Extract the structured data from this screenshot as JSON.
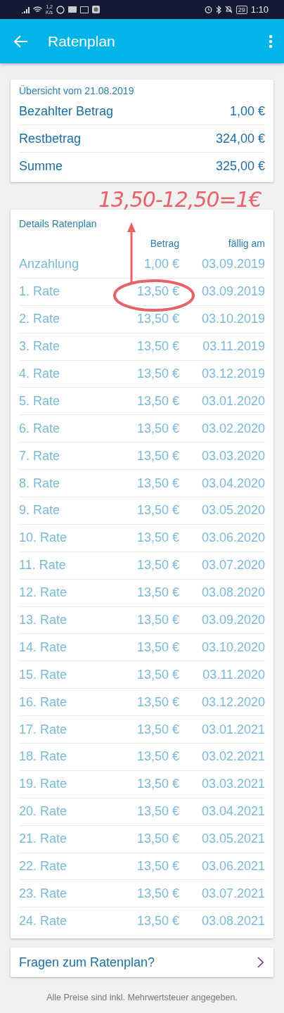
{
  "status_bar": {
    "speed_value": "1,2",
    "speed_unit": "K/s",
    "battery": "29",
    "time": "1:10"
  },
  "app_bar": {
    "title": "Ratenplan"
  },
  "overview": {
    "title": "Übersicht vom 21.08.2019",
    "rows": [
      {
        "label": "Bezahlter Betrag",
        "value": "1,00 €"
      },
      {
        "label": "Restbetrag",
        "value": "324,00 €"
      },
      {
        "label": "Summe",
        "value": "325,00 €"
      }
    ]
  },
  "annotation": {
    "text": "13,50-12,50=1€"
  },
  "details": {
    "title": "Details Ratenplan",
    "columns": [
      "Betrag",
      "fällig am"
    ],
    "rows": [
      {
        "label": "Anzahlung",
        "amount": "1,00 €",
        "due": "03.09.2019"
      },
      {
        "label": "1. Rate",
        "amount": "13,50 €",
        "due": "03.09.2019"
      },
      {
        "label": "2. Rate",
        "amount": "13,50 €",
        "due": "03.10.2019"
      },
      {
        "label": "3. Rate",
        "amount": "13,50 €",
        "due": "03.11.2019"
      },
      {
        "label": "4. Rate",
        "amount": "13,50 €",
        "due": "03.12.2019"
      },
      {
        "label": "5. Rate",
        "amount": "13,50 €",
        "due": "03.01.2020"
      },
      {
        "label": "6. Rate",
        "amount": "13,50 €",
        "due": "03.02.2020"
      },
      {
        "label": "7. Rate",
        "amount": "13,50 €",
        "due": "03.03.2020"
      },
      {
        "label": "8. Rate",
        "amount": "13,50 €",
        "due": "03.04.2020"
      },
      {
        "label": "9. Rate",
        "amount": "13,50 €",
        "due": "03.05.2020"
      },
      {
        "label": "10. Rate",
        "amount": "13,50 €",
        "due": "03.06.2020"
      },
      {
        "label": "11. Rate",
        "amount": "13,50 €",
        "due": "03.07.2020"
      },
      {
        "label": "12. Rate",
        "amount": "13,50 €",
        "due": "03.08.2020"
      },
      {
        "label": "13. Rate",
        "amount": "13,50 €",
        "due": "03.09.2020"
      },
      {
        "label": "14. Rate",
        "amount": "13,50 €",
        "due": "03.10.2020"
      },
      {
        "label": "15. Rate",
        "amount": "13,50 €",
        "due": "03.11.2020"
      },
      {
        "label": "16. Rate",
        "amount": "13,50 €",
        "due": "03.12.2020"
      },
      {
        "label": "17. Rate",
        "amount": "13,50 €",
        "due": "03.01.2021"
      },
      {
        "label": "18. Rate",
        "amount": "13,50 €",
        "due": "03.02.2021"
      },
      {
        "label": "19. Rate",
        "amount": "13,50 €",
        "due": "03.03.2021"
      },
      {
        "label": "20. Rate",
        "amount": "13,50 €",
        "due": "03.04.2021"
      },
      {
        "label": "21. Rate",
        "amount": "13,50 €",
        "due": "03.05.2021"
      },
      {
        "label": "22. Rate",
        "amount": "13,50 €",
        "due": "03.06.2021"
      },
      {
        "label": "23. Rate",
        "amount": "13,50 €",
        "due": "03.07.2021"
      },
      {
        "label": "24. Rate",
        "amount": "13,50 €",
        "due": "03.08.2021"
      }
    ]
  },
  "questions_link": {
    "label": "Fragen zum Ratenplan?"
  },
  "footer": "Alle Preise sind inkl. Mehrwertsteuer angegeben."
}
